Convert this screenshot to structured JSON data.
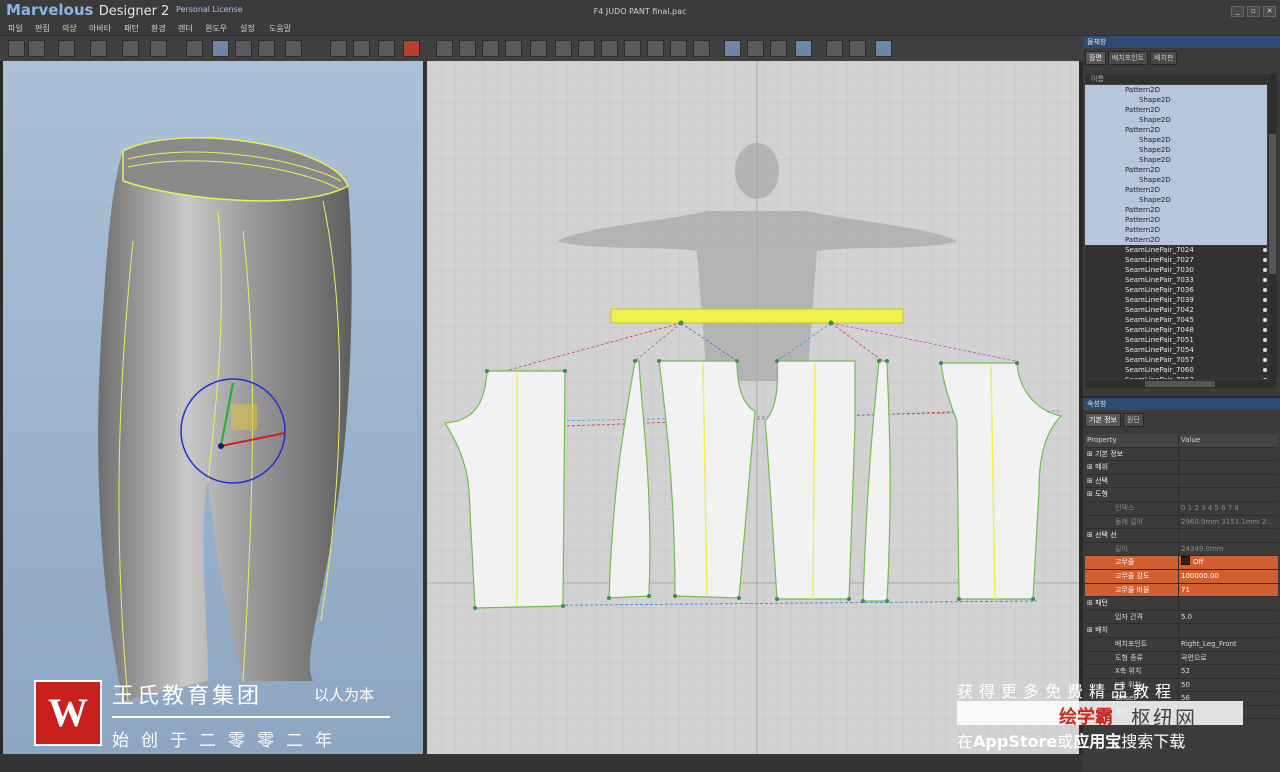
{
  "app": {
    "name": "Marvelous",
    "name_suffix": "Designer 2",
    "license": "Personal License",
    "document_title": "F4 JUDO PANT final.pac"
  },
  "menu": [
    "파일",
    "편집",
    "의상",
    "아바타",
    "패턴",
    "환경",
    "렌더",
    "윈도우",
    "설정",
    "도움말"
  ],
  "object_panel": {
    "title": "물체창",
    "tabs": [
      "장면",
      "배치포인트",
      "배치판"
    ],
    "column": "이름",
    "rows": [
      {
        "label": "Pattern2D",
        "indent": 1,
        "selected": true
      },
      {
        "label": "Shape2D",
        "indent": 2,
        "selected": true
      },
      {
        "label": "Pattern2D",
        "indent": 1,
        "selected": true
      },
      {
        "label": "Shape2D",
        "indent": 2,
        "selected": true
      },
      {
        "label": "Pattern2D",
        "indent": 1,
        "selected": true
      },
      {
        "label": "Shape2D",
        "indent": 2,
        "selected": true
      },
      {
        "label": "Shape2D",
        "indent": 2,
        "selected": true
      },
      {
        "label": "Shape2D",
        "indent": 2,
        "selected": true
      },
      {
        "label": "Pattern2D",
        "indent": 1,
        "selected": true
      },
      {
        "label": "Shape2D",
        "indent": 2,
        "selected": true
      },
      {
        "label": "Pattern2D",
        "indent": 1,
        "selected": true
      },
      {
        "label": "Shape2D",
        "indent": 2,
        "selected": true
      },
      {
        "label": "Pattern2D",
        "indent": 1,
        "selected": true
      },
      {
        "label": "Pattern2D",
        "indent": 1,
        "selected": true
      },
      {
        "label": "Pattern2D",
        "indent": 1,
        "selected": true
      },
      {
        "label": "Pattern2D",
        "indent": 1,
        "selected": true
      },
      {
        "label": "SeamLinePair_7024",
        "indent": 1,
        "selected": false
      },
      {
        "label": "SeamLinePair_7027",
        "indent": 1,
        "selected": false
      },
      {
        "label": "SeamLinePair_7030",
        "indent": 1,
        "selected": false
      },
      {
        "label": "SeamLinePair_7033",
        "indent": 1,
        "selected": false
      },
      {
        "label": "SeamLinePair_7036",
        "indent": 1,
        "selected": false
      },
      {
        "label": "SeamLinePair_7039",
        "indent": 1,
        "selected": false
      },
      {
        "label": "SeamLinePair_7042",
        "indent": 1,
        "selected": false
      },
      {
        "label": "SeamLinePair_7045",
        "indent": 1,
        "selected": false
      },
      {
        "label": "SeamLinePair_7048",
        "indent": 1,
        "selected": false
      },
      {
        "label": "SeamLinePair_7051",
        "indent": 1,
        "selected": false
      },
      {
        "label": "SeamLinePair_7054",
        "indent": 1,
        "selected": false
      },
      {
        "label": "SeamLinePair_7057",
        "indent": 1,
        "selected": false
      },
      {
        "label": "SeamLinePair_7060",
        "indent": 1,
        "selected": false
      },
      {
        "label": "SeamLinePair_7063",
        "indent": 1,
        "selected": false
      }
    ]
  },
  "property_panel": {
    "title": "속성창",
    "tabs": [
      "기본 정보",
      "원단"
    ],
    "col_property": "Property",
    "col_value": "Value",
    "rows": [
      {
        "key": "기본 정보",
        "value": "",
        "kind": "group"
      },
      {
        "key": "메쉬",
        "value": "",
        "kind": "group"
      },
      {
        "key": "선택",
        "value": "",
        "kind": "group"
      },
      {
        "key": "도형",
        "value": "",
        "kind": "group"
      },
      {
        "key": "인덱스",
        "value": "0 1 2 3 4 5 6 7 8",
        "kind": "dim"
      },
      {
        "key": "둘레 길이",
        "value": "2960.9mm 3151.1mm 2...",
        "kind": "dim"
      },
      {
        "key": "선택 선",
        "value": "",
        "kind": "group"
      },
      {
        "key": "길이",
        "value": "24349.0mm",
        "kind": "dim"
      },
      {
        "key": "고무줄",
        "value": "Off",
        "kind": "hl",
        "swatch": true
      },
      {
        "key": "고무줄 강도",
        "value": "100000.00",
        "kind": "hl"
      },
      {
        "key": "고무줄 비율",
        "value": "71",
        "kind": "hl"
      },
      {
        "key": "패턴",
        "value": "",
        "kind": "group"
      },
      {
        "key": "입자 간격",
        "value": "5.0",
        "kind": "item"
      },
      {
        "key": "배치",
        "value": "",
        "kind": "group"
      },
      {
        "key": "배치포인트",
        "value": "Right_Leg_Front",
        "kind": "item"
      },
      {
        "key": "도형 종류",
        "value": "곡면으로",
        "kind": "item"
      },
      {
        "key": "X축 위치",
        "value": "52",
        "kind": "item"
      },
      {
        "key": "Y축 위치",
        "value": "50",
        "kind": "item"
      },
      {
        "key": "Offset",
        "value": "56",
        "kind": "item"
      },
      {
        "key": "회전",
        "value": "180",
        "kind": "item"
      }
    ]
  },
  "watermark_left": {
    "logo": "W",
    "name": "王氏教育集团",
    "slogan": "以人为本",
    "since": "始创于二零零二年"
  },
  "watermark_right": {
    "line1": "获得更多免费精品教程",
    "brand": "绘学霸",
    "brand_suffix": "枢纽网",
    "line3_pre": "在",
    "line3_store1": "AppStore",
    "line3_mid": "或",
    "line3_store2": "应用宝",
    "line3_post": "搜索下载"
  },
  "colors": {
    "title_accent": "#8fb4e6",
    "selection_highlight": "#d15f2f",
    "panel_header": "#2e4b71",
    "seam_yellow": "#f0f050",
    "pattern_outline_green": "#6fbf4a"
  }
}
